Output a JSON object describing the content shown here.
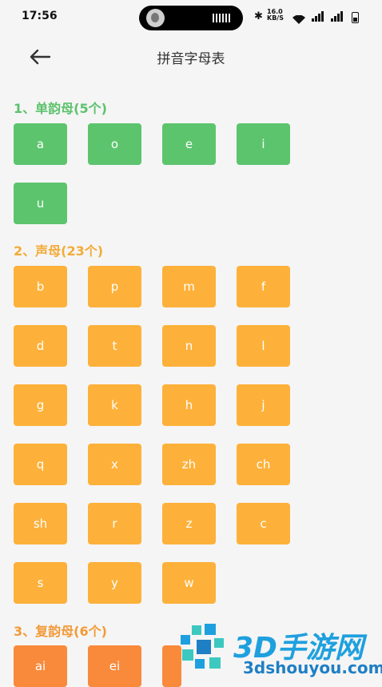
{
  "status": {
    "time": "17:56",
    "network_speed": "16.0\nKB/S"
  },
  "header": {
    "title": "拼音字母表"
  },
  "sections": [
    {
      "title": "1、单韵母(5个)",
      "items": [
        "a",
        "o",
        "e",
        "i",
        "u"
      ]
    },
    {
      "title": "2、声母(23个)",
      "items": [
        "b",
        "p",
        "m",
        "f",
        "d",
        "t",
        "n",
        "l",
        "g",
        "k",
        "h",
        "j",
        "q",
        "x",
        "zh",
        "ch",
        "sh",
        "r",
        "z",
        "c",
        "s",
        "y",
        "w"
      ]
    },
    {
      "title": "3、复韵母(6个)",
      "items": [
        "ai",
        "ei"
      ]
    }
  ],
  "watermark": {
    "brand": "3D手游网",
    "url": "3dshouyou.com"
  },
  "colors": {
    "green": "#5dc46e",
    "yellow": "#fdb13a",
    "orange": "#f98a3c",
    "watermark": "#1fa0de"
  },
  "icons": {
    "back": "arrow-left-icon",
    "bluetooth": "bluetooth-icon",
    "wifi": "wifi-icon",
    "signal": "signal-icon",
    "battery": "battery-icon"
  }
}
